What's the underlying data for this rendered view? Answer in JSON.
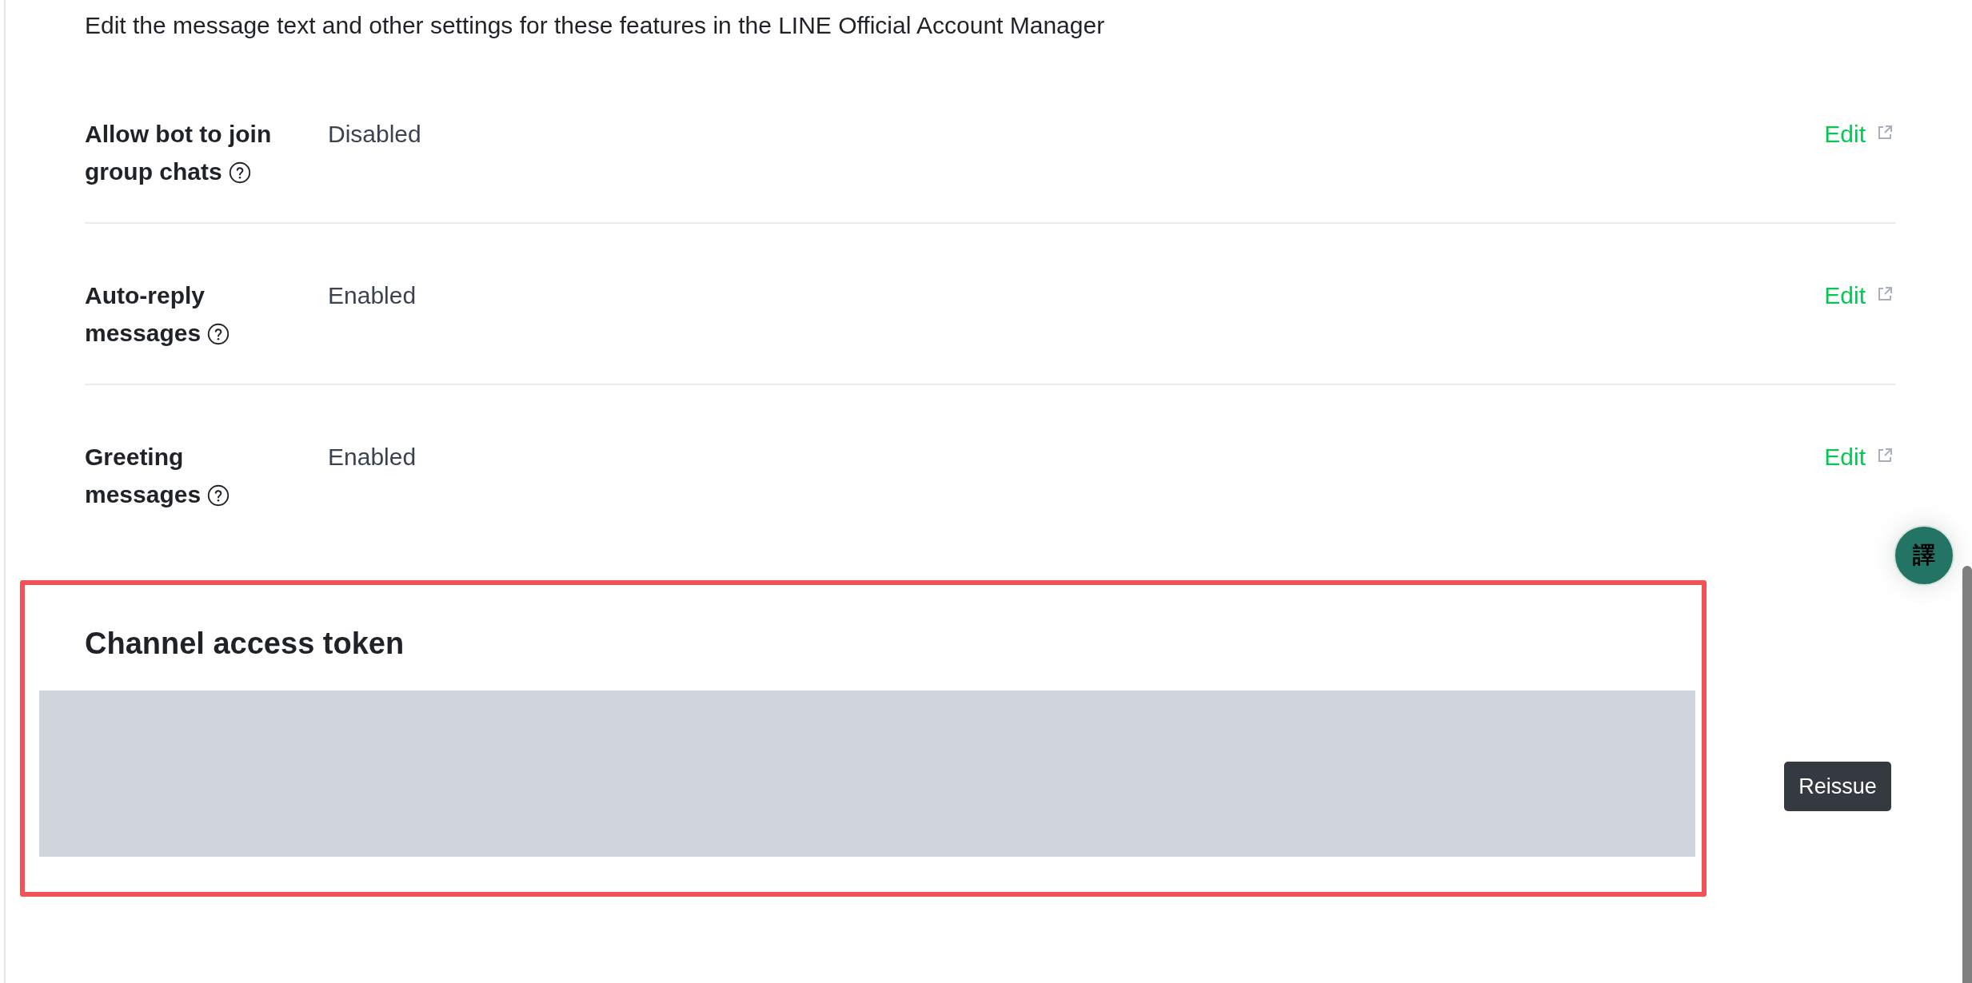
{
  "intro": "Edit the message text and other settings for these features in the LINE Official Account Manager",
  "settings": [
    {
      "label": "Allow bot to join group chats",
      "value": "Disabled",
      "link": "Edit"
    },
    {
      "label": "Auto-reply messages",
      "value": "Enabled",
      "link": "Edit"
    },
    {
      "label": "Greeting messages",
      "value": "Enabled",
      "link": "Edit"
    }
  ],
  "token_section": {
    "title": "Channel access token",
    "button": "Reissue"
  },
  "translate_button": "譯"
}
